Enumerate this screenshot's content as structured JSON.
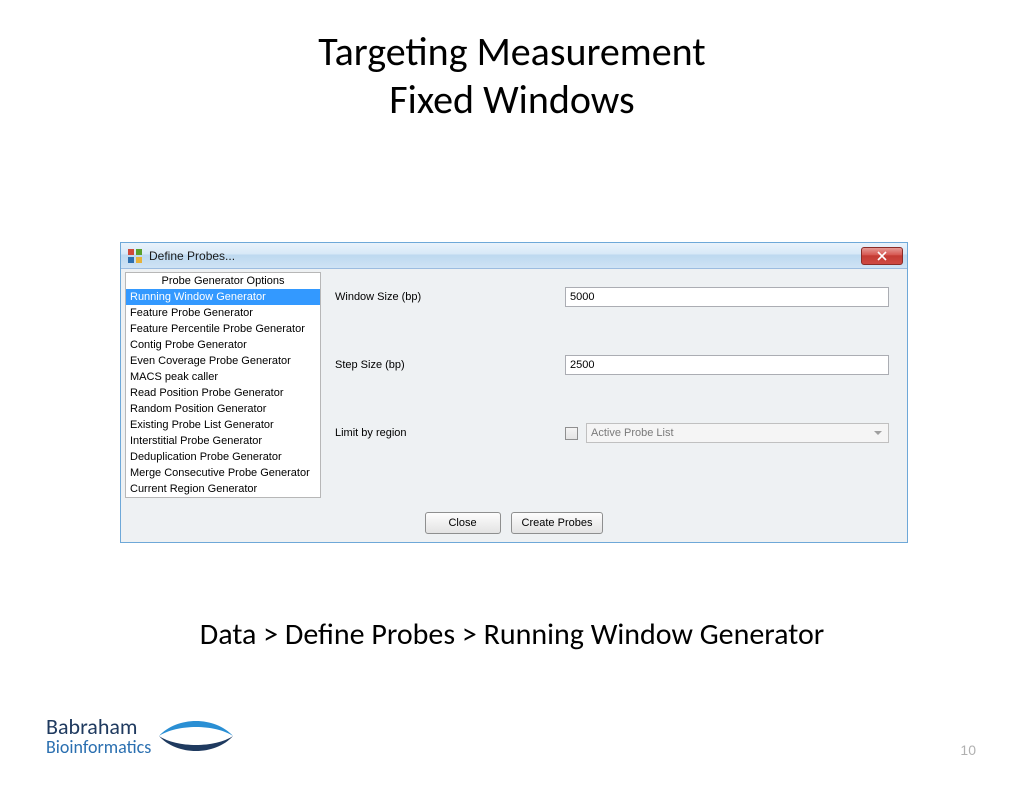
{
  "slide": {
    "title_line1": "Targeting Measurement",
    "title_line2": "Fixed Windows",
    "breadcrumb": "Data > Define Probes > Running Window Generator",
    "page_number": "10"
  },
  "logo": {
    "line1": "Babraham",
    "line2": "Bioinformatics"
  },
  "dialog": {
    "title": "Define Probes...",
    "sidebar_header": "Probe Generator Options",
    "options": [
      "Running Window Generator",
      "Feature Probe Generator",
      "Feature Percentile Probe Generator",
      "Contig Probe Generator",
      "Even Coverage Probe Generator",
      "MACS peak caller",
      "Read Position Probe Generator",
      "Random Position Generator",
      "Existing Probe List Generator",
      "Interstitial Probe Generator",
      "Deduplication Probe Generator",
      "Merge Consecutive Probe Generator",
      "Current Region Generator"
    ],
    "selected_index": 0,
    "form": {
      "window_size_label": "Window Size (bp)",
      "window_size_value": "5000",
      "step_size_label": "Step Size (bp)",
      "step_size_value": "2500",
      "limit_label": "Limit by region",
      "limit_dropdown": "Active Probe List"
    },
    "buttons": {
      "close": "Close",
      "create": "Create Probes"
    }
  }
}
